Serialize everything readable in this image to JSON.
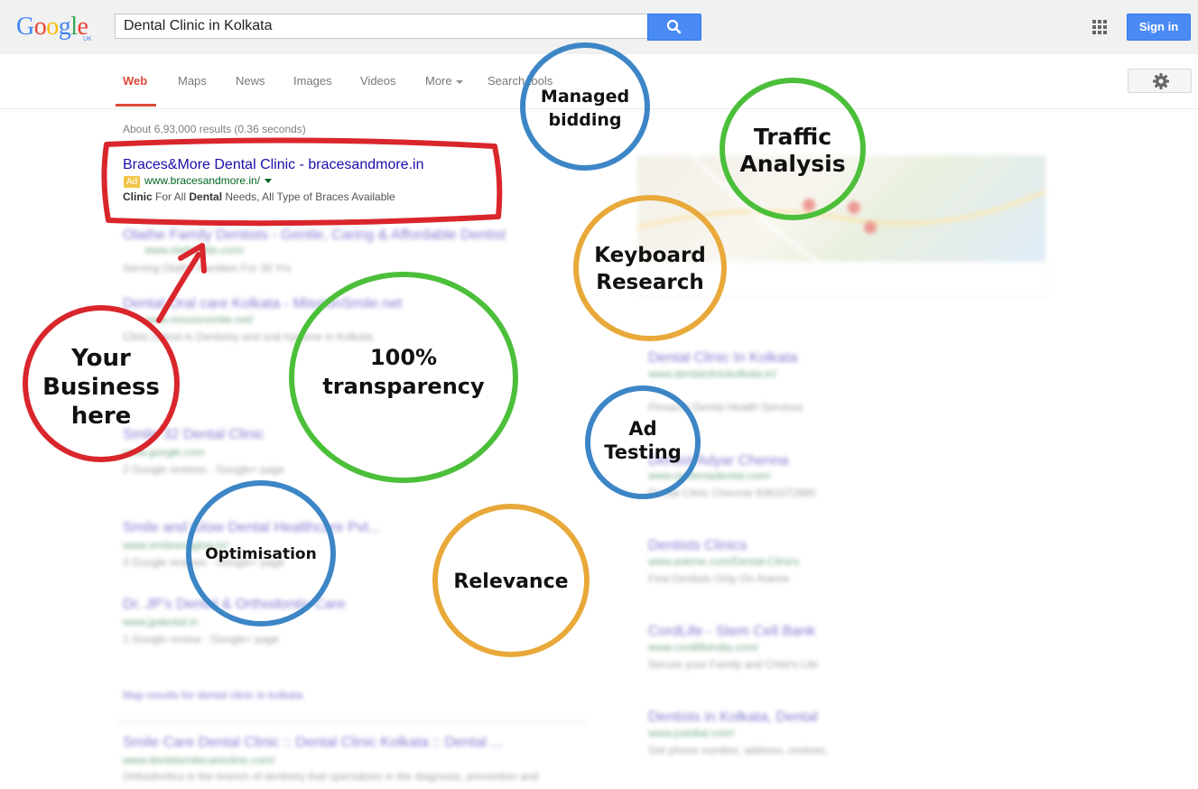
{
  "header": {
    "logo_letters": [
      {
        "ch": "G",
        "color": "#4285f4"
      },
      {
        "ch": "o",
        "color": "#ea4335"
      },
      {
        "ch": "o",
        "color": "#fbbc05"
      },
      {
        "ch": "g",
        "color": "#4285f4"
      },
      {
        "ch": "l",
        "color": "#34a853"
      },
      {
        "ch": "e",
        "color": "#ea4335"
      }
    ],
    "logo_sub": "UK",
    "search_value": "Dental Clinic in Kolkata",
    "search_icon": "magnifier-icon",
    "apps_icon": "apps-grid-icon",
    "signin_label": "Sign in"
  },
  "tabs": {
    "web": "Web",
    "maps": "Maps",
    "news": "News",
    "images": "Images",
    "videos": "Videos",
    "more": "More",
    "search_tools": "Search tools",
    "settings_icon": "gear-icon"
  },
  "results": {
    "stats": "About 6,93,000 results (0.36 seconds)",
    "ad": {
      "title": "Braces&More Dental Clinic - bracesandmore.in",
      "badge": "Ad",
      "url": "www.bracesandmore.in/",
      "desc_clinic": "Clinic",
      "desc_mid1": " For All ",
      "desc_dental": "Dental",
      "desc_rest": " Needs, All Type of Braces Available"
    },
    "blurred_left": [
      {
        "title": "Olathe Family Dentists - Gentle, Caring & Affordable Dentist",
        "url": "www.olathedds.com/",
        "text": "Serving Olathe Families For 30 Yrs"
      },
      {
        "title": "Dental Oral care Kolkata - MissionSmile.net",
        "url": "www.missionsmile.net/",
        "text": "Clinic Latest in Dentistry and oral hygiene in Kolkata"
      },
      {
        "title": "Smile 32 Dental Clinic",
        "url": "www.google.com",
        "text": "2 Google reviews · Google+ page"
      },
      {
        "title": "Smile and Glow Dental Healthcare Pvt...",
        "url": "www.smileandglow.in/",
        "text": "3 Google reviews · Google+ page"
      },
      {
        "title": "Dr. JP's Dental & Orthodontic Care",
        "url": "www.jpdental.in",
        "text": "1 Google review · Google+ page"
      },
      {
        "title": "Smile Care Dental Clinic :: Dental Clinic Kolkata :: Dental ...",
        "url": "www.dentalsmilecareclinic.com/",
        "text": "Orthodontics is the branch of dentistry that specializes in the diagnosis, prevention and"
      }
    ],
    "map_results_link": "Map results for dental clinic in kolkata",
    "blurred_right": [
      {
        "title": "Dental Clinic In Kolkata",
        "url": "www.dentalclinickolkata.in/",
        "text": "Pinnacle Dental Health Services"
      },
      {
        "title": "Dentist Adyar Chenna",
        "url": "www.smilemadental.com/",
        "text": "Dental Clinic Chennai 9361072890"
      },
      {
        "title": "Dentists Clinics",
        "url": "www.askme.com/Dental-Clinics",
        "text": "Find Dentists Only On Askme"
      },
      {
        "title": "CordLife - Stem Cell Bank",
        "url": "www.cordlifeindia.com/",
        "text": "Secure your Family and Child's Life"
      },
      {
        "title": "Dentists in Kolkata, Dental",
        "url": "www.justdial.com/",
        "text": "Get phone number, address, reviews,"
      }
    ]
  },
  "annotations": {
    "your_business": [
      "Your",
      "Business",
      "here"
    ],
    "managed_bidding": [
      "Managed",
      "bidding"
    ],
    "traffic_analysis": [
      "Traffic",
      "Analysis"
    ],
    "keyboard_research": [
      "Keyboard",
      "Research"
    ],
    "transparency": [
      "100%",
      "transparency"
    ],
    "ad_testing": [
      "Ad",
      "Testing"
    ],
    "optimisation": [
      "Optimisation"
    ],
    "relevance": [
      "Relevance"
    ],
    "colors": {
      "red": "#d9262c",
      "blue": "#3d86c6",
      "green": "#4cbf3a",
      "orange": "#e8a93a"
    }
  }
}
